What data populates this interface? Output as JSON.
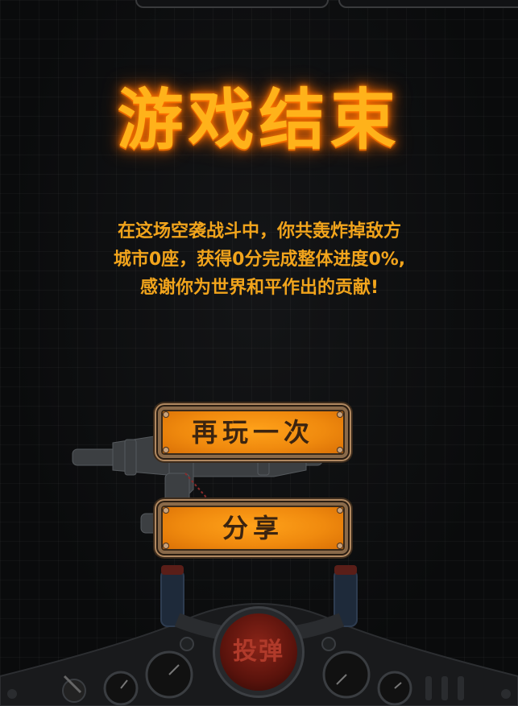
{
  "title": "游戏结束",
  "message": "在这场空袭战斗中，你共轰炸掉敌方城市0座，获得0分完成整体进度0%,感谢你为世界和平作出的贡献!",
  "buttons": {
    "replay": "再玩一次",
    "share": "分享"
  },
  "cockpit": {
    "fire_label": "投弹"
  },
  "colors": {
    "title": "#ffb21a",
    "message": "#f1a41c",
    "button": "#f08a0e",
    "fire": "#8a2418"
  },
  "icons": [
    "plane-icon",
    "gauge-icon",
    "joystick-icon"
  ]
}
